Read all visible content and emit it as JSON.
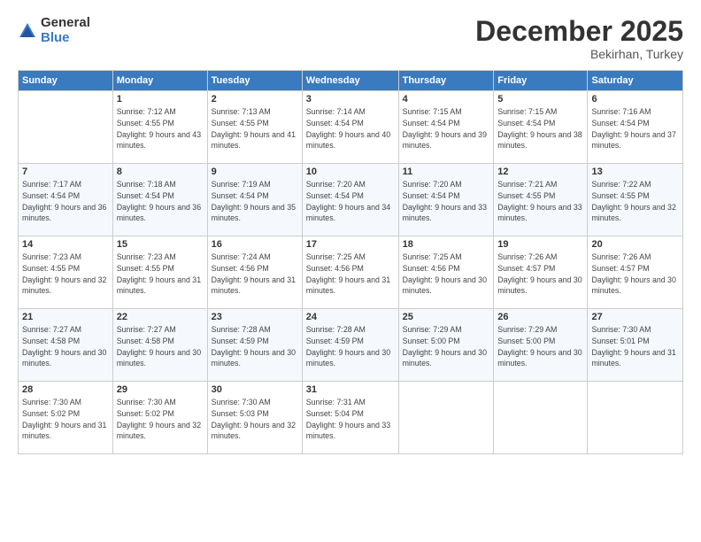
{
  "logo": {
    "general": "General",
    "blue": "Blue"
  },
  "header": {
    "month_year": "December 2025",
    "location": "Bekirhan, Turkey"
  },
  "weekdays": [
    "Sunday",
    "Monday",
    "Tuesday",
    "Wednesday",
    "Thursday",
    "Friday",
    "Saturday"
  ],
  "weeks": [
    [
      {
        "day": "",
        "sunrise": "",
        "sunset": "",
        "daylight": ""
      },
      {
        "day": "1",
        "sunrise": "Sunrise: 7:12 AM",
        "sunset": "Sunset: 4:55 PM",
        "daylight": "Daylight: 9 hours and 43 minutes."
      },
      {
        "day": "2",
        "sunrise": "Sunrise: 7:13 AM",
        "sunset": "Sunset: 4:55 PM",
        "daylight": "Daylight: 9 hours and 41 minutes."
      },
      {
        "day": "3",
        "sunrise": "Sunrise: 7:14 AM",
        "sunset": "Sunset: 4:54 PM",
        "daylight": "Daylight: 9 hours and 40 minutes."
      },
      {
        "day": "4",
        "sunrise": "Sunrise: 7:15 AM",
        "sunset": "Sunset: 4:54 PM",
        "daylight": "Daylight: 9 hours and 39 minutes."
      },
      {
        "day": "5",
        "sunrise": "Sunrise: 7:15 AM",
        "sunset": "Sunset: 4:54 PM",
        "daylight": "Daylight: 9 hours and 38 minutes."
      },
      {
        "day": "6",
        "sunrise": "Sunrise: 7:16 AM",
        "sunset": "Sunset: 4:54 PM",
        "daylight": "Daylight: 9 hours and 37 minutes."
      }
    ],
    [
      {
        "day": "7",
        "sunrise": "Sunrise: 7:17 AM",
        "sunset": "Sunset: 4:54 PM",
        "daylight": "Daylight: 9 hours and 36 minutes."
      },
      {
        "day": "8",
        "sunrise": "Sunrise: 7:18 AM",
        "sunset": "Sunset: 4:54 PM",
        "daylight": "Daylight: 9 hours and 36 minutes."
      },
      {
        "day": "9",
        "sunrise": "Sunrise: 7:19 AM",
        "sunset": "Sunset: 4:54 PM",
        "daylight": "Daylight: 9 hours and 35 minutes."
      },
      {
        "day": "10",
        "sunrise": "Sunrise: 7:20 AM",
        "sunset": "Sunset: 4:54 PM",
        "daylight": "Daylight: 9 hours and 34 minutes."
      },
      {
        "day": "11",
        "sunrise": "Sunrise: 7:20 AM",
        "sunset": "Sunset: 4:54 PM",
        "daylight": "Daylight: 9 hours and 33 minutes."
      },
      {
        "day": "12",
        "sunrise": "Sunrise: 7:21 AM",
        "sunset": "Sunset: 4:55 PM",
        "daylight": "Daylight: 9 hours and 33 minutes."
      },
      {
        "day": "13",
        "sunrise": "Sunrise: 7:22 AM",
        "sunset": "Sunset: 4:55 PM",
        "daylight": "Daylight: 9 hours and 32 minutes."
      }
    ],
    [
      {
        "day": "14",
        "sunrise": "Sunrise: 7:23 AM",
        "sunset": "Sunset: 4:55 PM",
        "daylight": "Daylight: 9 hours and 32 minutes."
      },
      {
        "day": "15",
        "sunrise": "Sunrise: 7:23 AM",
        "sunset": "Sunset: 4:55 PM",
        "daylight": "Daylight: 9 hours and 31 minutes."
      },
      {
        "day": "16",
        "sunrise": "Sunrise: 7:24 AM",
        "sunset": "Sunset: 4:56 PM",
        "daylight": "Daylight: 9 hours and 31 minutes."
      },
      {
        "day": "17",
        "sunrise": "Sunrise: 7:25 AM",
        "sunset": "Sunset: 4:56 PM",
        "daylight": "Daylight: 9 hours and 31 minutes."
      },
      {
        "day": "18",
        "sunrise": "Sunrise: 7:25 AM",
        "sunset": "Sunset: 4:56 PM",
        "daylight": "Daylight: 9 hours and 30 minutes."
      },
      {
        "day": "19",
        "sunrise": "Sunrise: 7:26 AM",
        "sunset": "Sunset: 4:57 PM",
        "daylight": "Daylight: 9 hours and 30 minutes."
      },
      {
        "day": "20",
        "sunrise": "Sunrise: 7:26 AM",
        "sunset": "Sunset: 4:57 PM",
        "daylight": "Daylight: 9 hours and 30 minutes."
      }
    ],
    [
      {
        "day": "21",
        "sunrise": "Sunrise: 7:27 AM",
        "sunset": "Sunset: 4:58 PM",
        "daylight": "Daylight: 9 hours and 30 minutes."
      },
      {
        "day": "22",
        "sunrise": "Sunrise: 7:27 AM",
        "sunset": "Sunset: 4:58 PM",
        "daylight": "Daylight: 9 hours and 30 minutes."
      },
      {
        "day": "23",
        "sunrise": "Sunrise: 7:28 AM",
        "sunset": "Sunset: 4:59 PM",
        "daylight": "Daylight: 9 hours and 30 minutes."
      },
      {
        "day": "24",
        "sunrise": "Sunrise: 7:28 AM",
        "sunset": "Sunset: 4:59 PM",
        "daylight": "Daylight: 9 hours and 30 minutes."
      },
      {
        "day": "25",
        "sunrise": "Sunrise: 7:29 AM",
        "sunset": "Sunset: 5:00 PM",
        "daylight": "Daylight: 9 hours and 30 minutes."
      },
      {
        "day": "26",
        "sunrise": "Sunrise: 7:29 AM",
        "sunset": "Sunset: 5:00 PM",
        "daylight": "Daylight: 9 hours and 30 minutes."
      },
      {
        "day": "27",
        "sunrise": "Sunrise: 7:30 AM",
        "sunset": "Sunset: 5:01 PM",
        "daylight": "Daylight: 9 hours and 31 minutes."
      }
    ],
    [
      {
        "day": "28",
        "sunrise": "Sunrise: 7:30 AM",
        "sunset": "Sunset: 5:02 PM",
        "daylight": "Daylight: 9 hours and 31 minutes."
      },
      {
        "day": "29",
        "sunrise": "Sunrise: 7:30 AM",
        "sunset": "Sunset: 5:02 PM",
        "daylight": "Daylight: 9 hours and 32 minutes."
      },
      {
        "day": "30",
        "sunrise": "Sunrise: 7:30 AM",
        "sunset": "Sunset: 5:03 PM",
        "daylight": "Daylight: 9 hours and 32 minutes."
      },
      {
        "day": "31",
        "sunrise": "Sunrise: 7:31 AM",
        "sunset": "Sunset: 5:04 PM",
        "daylight": "Daylight: 9 hours and 33 minutes."
      },
      {
        "day": "",
        "sunrise": "",
        "sunset": "",
        "daylight": ""
      },
      {
        "day": "",
        "sunrise": "",
        "sunset": "",
        "daylight": ""
      },
      {
        "day": "",
        "sunrise": "",
        "sunset": "",
        "daylight": ""
      }
    ]
  ]
}
